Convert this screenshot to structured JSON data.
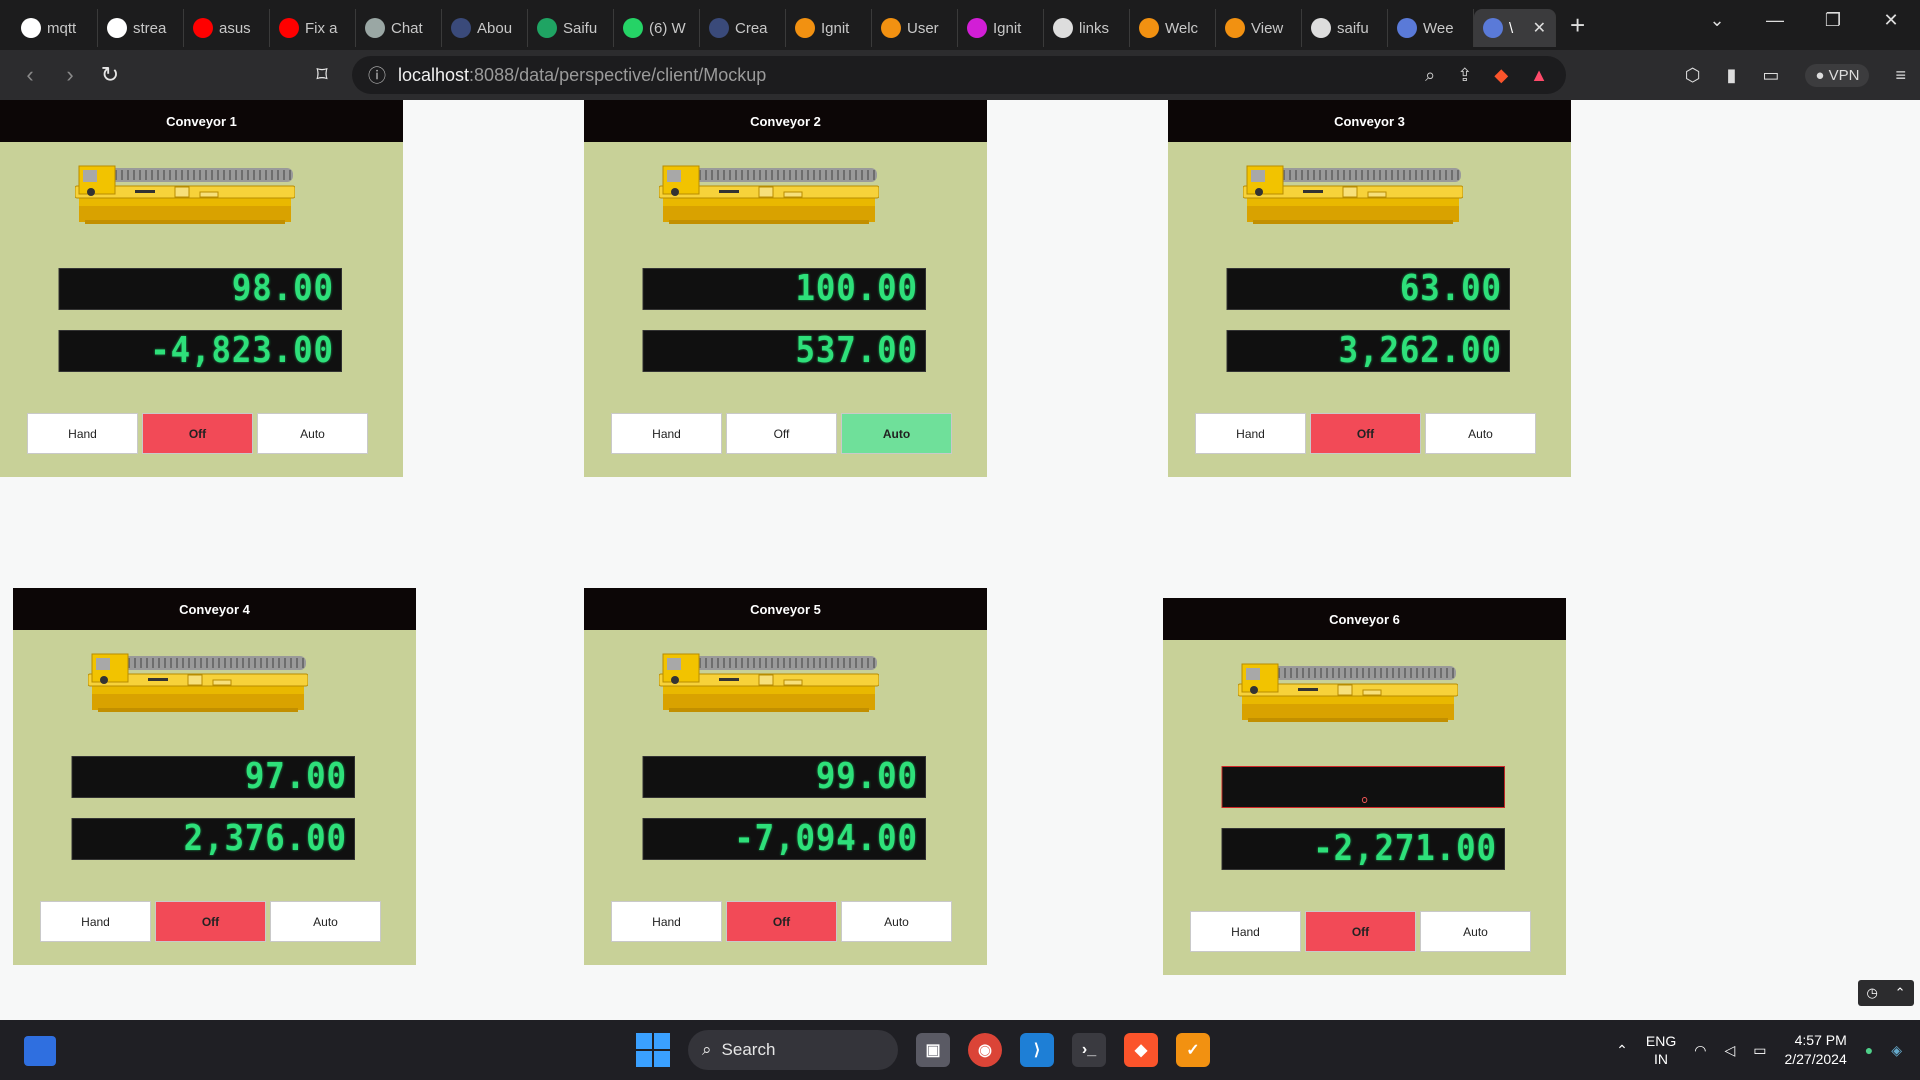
{
  "browser": {
    "tabs": [
      {
        "label": "mqtt",
        "icon": "google-icon",
        "color": "#ffffff"
      },
      {
        "label": "strea",
        "icon": "google-icon",
        "color": "#ffffff"
      },
      {
        "label": "asus",
        "icon": "youtube-icon",
        "color": "#ff0000"
      },
      {
        "label": "Fix a",
        "icon": "youtube-icon",
        "color": "#ff0000"
      },
      {
        "label": "Chat",
        "icon": "chatgpt-icon",
        "color": "#9aa7a4"
      },
      {
        "label": "Abou",
        "icon": "iu-icon",
        "color": "#3a4a7a"
      },
      {
        "label": "Saifu",
        "icon": "sheets-icon",
        "color": "#1fa463"
      },
      {
        "label": "(6) W",
        "icon": "whatsapp-icon",
        "color": "#25d366"
      },
      {
        "label": "Crea",
        "icon": "iu-icon",
        "color": "#3a4a7a"
      },
      {
        "label": "Ignit",
        "icon": "ignition-icon",
        "color": "#f29111"
      },
      {
        "label": "User",
        "icon": "ignition-check-icon",
        "color": "#f29111"
      },
      {
        "label": "Ignit",
        "icon": "xd-icon",
        "color": "#d21ed6"
      },
      {
        "label": "links",
        "icon": "globe-icon",
        "color": "#dddddd"
      },
      {
        "label": "Welc",
        "icon": "ignition-check-icon",
        "color": "#f29111"
      },
      {
        "label": "View",
        "icon": "ignition-check-icon",
        "color": "#f29111"
      },
      {
        "label": "saifu",
        "icon": "github-icon",
        "color": "#dddddd"
      },
      {
        "label": "Wee",
        "icon": "ignition-check-icon",
        "color": "#5a7ad8"
      },
      {
        "label": "\\",
        "icon": "ignition-check-icon",
        "color": "#5a7ad8",
        "active": true
      }
    ],
    "url_host": "localhost",
    "url_path": ":8088/data/perspective/client/Mockup",
    "vpn_label": "VPN"
  },
  "conveyors": [
    {
      "title": "Conveyor 1",
      "value1": "98.00",
      "value2": "-4,823.00",
      "mode": "Off"
    },
    {
      "title": "Conveyor 2",
      "value1": "100.00",
      "value2": "537.00",
      "mode": "Auto"
    },
    {
      "title": "Conveyor 3",
      "value1": "63.00",
      "value2": "3,262.00",
      "mode": "Off"
    },
    {
      "title": "Conveyor 4",
      "value1": "97.00",
      "value2": "2,376.00",
      "mode": "Off"
    },
    {
      "title": "Conveyor 5",
      "value1": "99.00",
      "value2": "-7,094.00",
      "mode": "Off"
    },
    {
      "title": "Conveyor 6",
      "value1": "",
      "value2": "-2,271.00",
      "mode": "Off"
    }
  ],
  "buttons": {
    "hand": "Hand",
    "off": "Off",
    "auto": "Auto"
  },
  "taskbar": {
    "search_label": "Search",
    "lang_line1": "ENG",
    "lang_line2": "IN",
    "time": "4:57 PM",
    "date": "2/27/2024"
  },
  "colors": {
    "card_bg": "#c8d198",
    "header_bg": "#0c0606",
    "lcd_text": "#2ee07a",
    "off_active": "#f24a57",
    "auto_active": "#6fe09a"
  }
}
